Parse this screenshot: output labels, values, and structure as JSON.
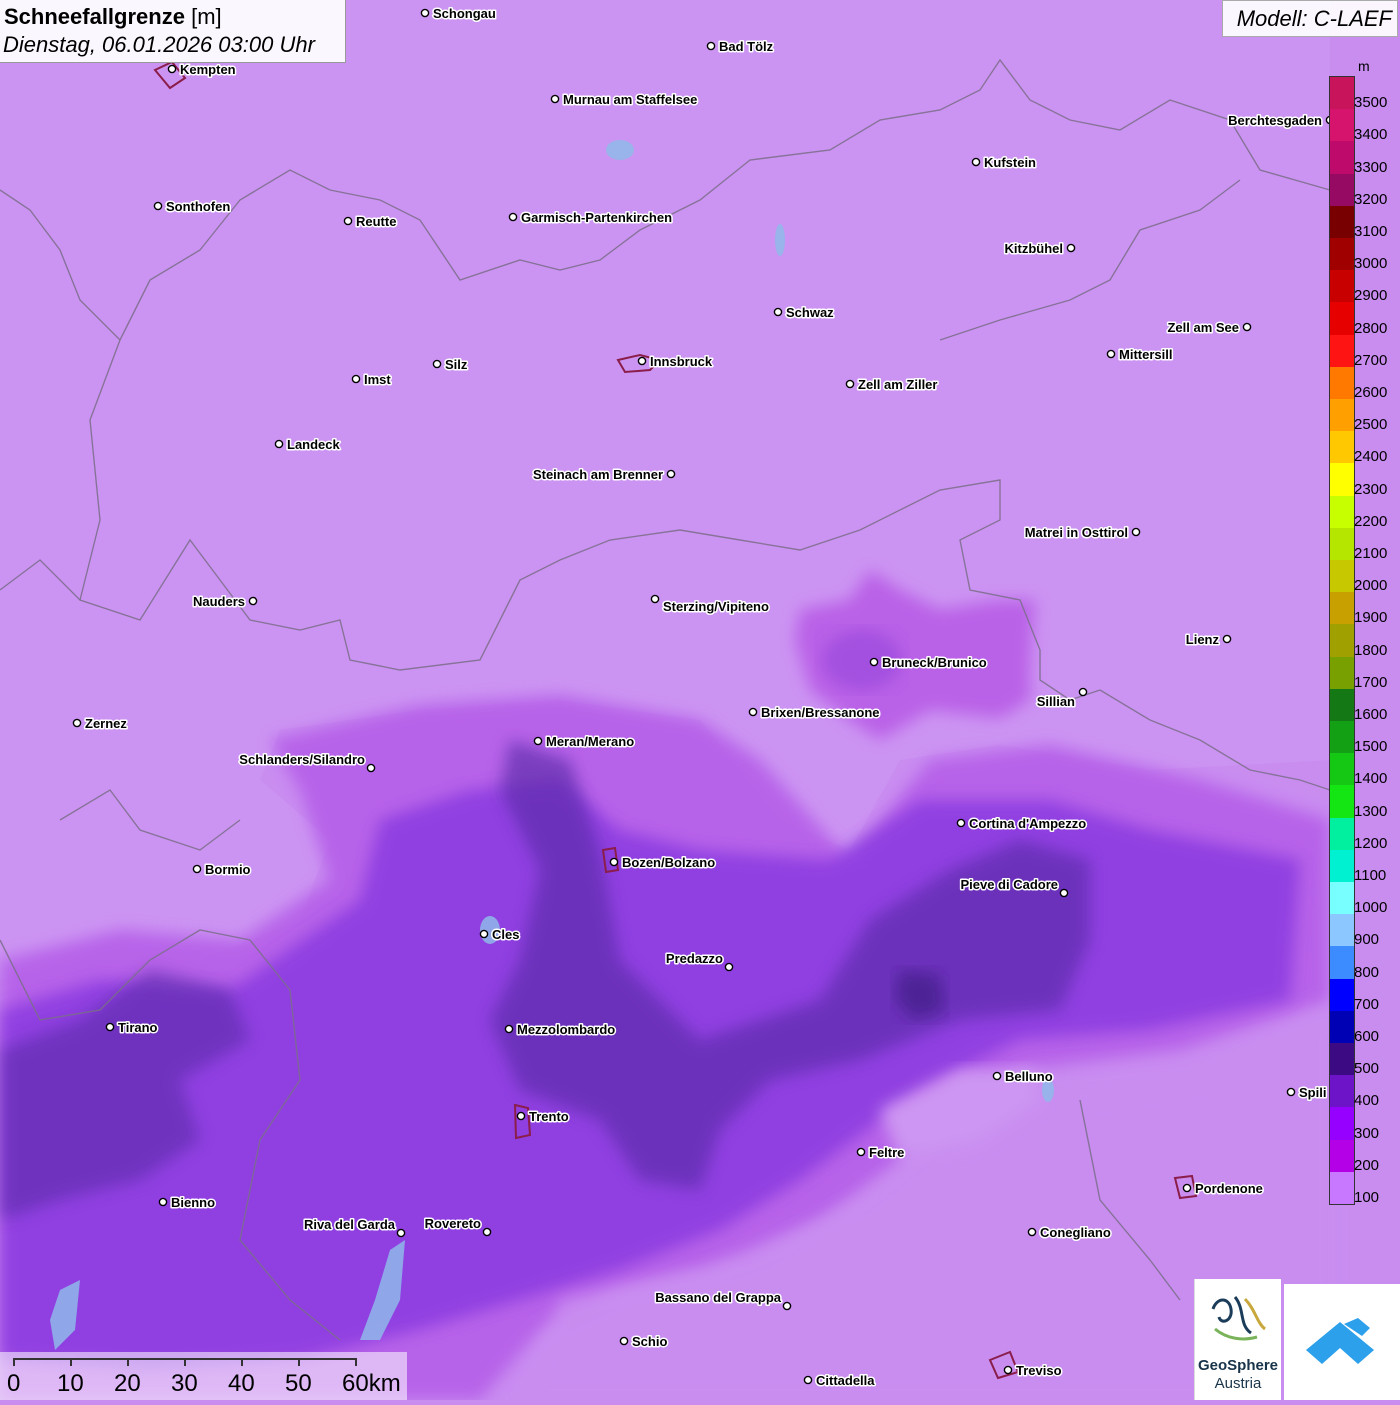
{
  "header": {
    "title": "Schneefallgrenze",
    "unit": "[m]",
    "datetime": "Dienstag, 06.01.2026 03:00 Uhr",
    "model": "Modell: C-LAEF"
  },
  "legend": {
    "unit": "m",
    "items": [
      {
        "label": "3500",
        "color": "#c8145a"
      },
      {
        "label": "3400",
        "color": "#d6146e"
      },
      {
        "label": "3300",
        "color": "#be0a6a"
      },
      {
        "label": "3200",
        "color": "#960a64"
      },
      {
        "label": "3100",
        "color": "#780000"
      },
      {
        "label": "3000",
        "color": "#a00000"
      },
      {
        "label": "2900",
        "color": "#c80000"
      },
      {
        "label": "2800",
        "color": "#e60000"
      },
      {
        "label": "2700",
        "color": "#ff1414"
      },
      {
        "label": "2600",
        "color": "#ff7800"
      },
      {
        "label": "2500",
        "color": "#ffa000"
      },
      {
        "label": "2400",
        "color": "#ffc800"
      },
      {
        "label": "2300",
        "color": "#ffff00"
      },
      {
        "label": "2200",
        "color": "#c8ff00"
      },
      {
        "label": "2100",
        "color": "#b4e600"
      },
      {
        "label": "2000",
        "color": "#c8c800"
      },
      {
        "label": "1900",
        "color": "#c8a000"
      },
      {
        "label": "1800",
        "color": "#a0a000"
      },
      {
        "label": "1700",
        "color": "#78a000"
      },
      {
        "label": "1600",
        "color": "#147814"
      },
      {
        "label": "1500",
        "color": "#14a014"
      },
      {
        "label": "1400",
        "color": "#14c814"
      },
      {
        "label": "1300",
        "color": "#14e614"
      },
      {
        "label": "1200",
        "color": "#00f0a0"
      },
      {
        "label": "1100",
        "color": "#00f0d2"
      },
      {
        "label": "1000",
        "color": "#78ffff"
      },
      {
        "label": "900",
        "color": "#8cc8ff"
      },
      {
        "label": "800",
        "color": "#3c8cff"
      },
      {
        "label": "700",
        "color": "#0000ff"
      },
      {
        "label": "600",
        "color": "#0000b4"
      },
      {
        "label": "500",
        "color": "#3c0a82"
      },
      {
        "label": "400",
        "color": "#6e14c8"
      },
      {
        "label": "300",
        "color": "#9600ff"
      },
      {
        "label": "200",
        "color": "#b400e6"
      },
      {
        "label": "100",
        "color": "#c878ff"
      }
    ]
  },
  "scale_bar": {
    "labels": [
      "0",
      "10",
      "20",
      "30",
      "40",
      "50",
      "60km"
    ]
  },
  "cities": [
    {
      "name": "Schongau"
    },
    {
      "name": "Bad Tölz"
    },
    {
      "name": "Kempten"
    },
    {
      "name": "Murnau am Staffelsee"
    },
    {
      "name": "Berchtesgaden"
    },
    {
      "name": "Kufstein"
    },
    {
      "name": "Sonthofen"
    },
    {
      "name": "Reutte"
    },
    {
      "name": "Garmisch-Partenkirchen"
    },
    {
      "name": "Kitzbühel"
    },
    {
      "name": "Schwaz"
    },
    {
      "name": "Zell am See"
    },
    {
      "name": "Mittersill"
    },
    {
      "name": "Innsbruck"
    },
    {
      "name": "Silz"
    },
    {
      "name": "Imst"
    },
    {
      "name": "Zell am Ziller"
    },
    {
      "name": "Landeck"
    },
    {
      "name": "Steinach am Brenner"
    },
    {
      "name": "Matrei in Osttirol"
    },
    {
      "name": "Nauders"
    },
    {
      "name": "Sterzing/Vipiteno"
    },
    {
      "name": "Lienz"
    },
    {
      "name": "Bruneck/Brunico"
    },
    {
      "name": "Sillian"
    },
    {
      "name": "Zernez"
    },
    {
      "name": "Brixen/Bressanone"
    },
    {
      "name": "Meran/Merano"
    },
    {
      "name": "Schlanders/Silandro"
    },
    {
      "name": "Cortina d'Ampezzo"
    },
    {
      "name": "Bozen/Bolzano"
    },
    {
      "name": "Bormio"
    },
    {
      "name": "Pieve di Cadore"
    },
    {
      "name": "Cles"
    },
    {
      "name": "Predazzo"
    },
    {
      "name": "Tirano"
    },
    {
      "name": "Mezzolombardo"
    },
    {
      "name": "Belluno"
    },
    {
      "name": "Spili"
    },
    {
      "name": "Trento"
    },
    {
      "name": "Feltre"
    },
    {
      "name": "Pordenone"
    },
    {
      "name": "Bienno"
    },
    {
      "name": "Riva del Garda"
    },
    {
      "name": "Rovereto"
    },
    {
      "name": "Conegliano"
    },
    {
      "name": "Bassano del Grappa"
    },
    {
      "name": "Schio"
    },
    {
      "name": "Treviso"
    },
    {
      "name": "Cittadella"
    }
  ],
  "logos": {
    "geosphere_line1": "GeoSphere",
    "geosphere_line2": "Austria"
  }
}
